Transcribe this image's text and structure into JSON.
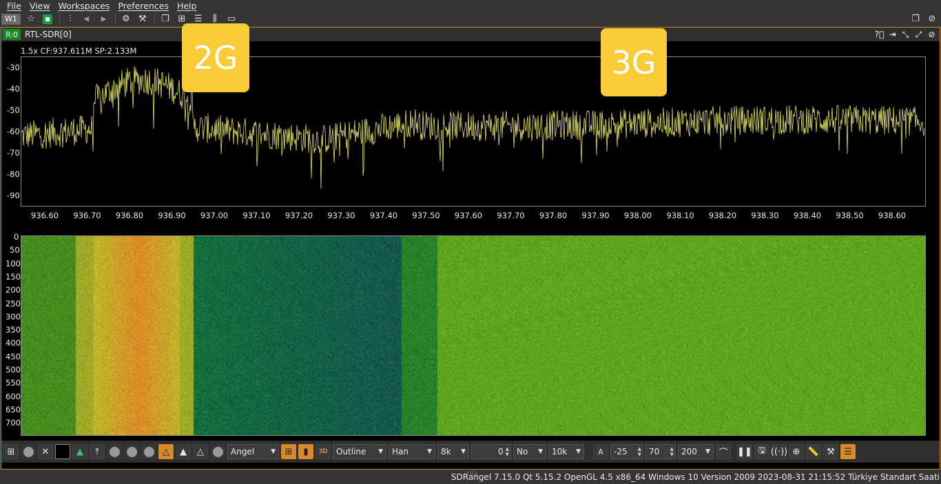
{
  "menubar": {
    "items": [
      "File",
      "View",
      "Workspaces",
      "Preferences",
      "Help"
    ]
  },
  "toolbar": {
    "workspace_badge": "W1"
  },
  "panel": {
    "rx_badge": "R:0",
    "title": "RTL-SDR[0]"
  },
  "spectrum": {
    "info_line": "1.5x CF:937.611M SP:2.133M",
    "y_ticks": [
      "-30",
      "-40",
      "-50",
      "-60",
      "-70",
      "-80",
      "-90"
    ],
    "x_ticks": [
      "936.60",
      "936.70",
      "936.80",
      "936.90",
      "937.00",
      "937.10",
      "937.20",
      "937.30",
      "937.40",
      "937.50",
      "937.60",
      "937.70",
      "937.80",
      "937.90",
      "938.00",
      "938.10",
      "938.20",
      "938.30",
      "938.40",
      "938.50",
      "938.60"
    ],
    "trace_color": "#e6e36a"
  },
  "waterfall": {
    "ticks": [
      "0",
      "50",
      "100",
      "150",
      "200",
      "250",
      "300",
      "350",
      "400",
      "450",
      "500",
      "550",
      "600",
      "650",
      "700"
    ]
  },
  "overlays": {
    "label_2g": "2G",
    "label_3g": "3G",
    "color": "#f9cc35"
  },
  "controls": {
    "palette": "Angel",
    "fft_style": "Outline",
    "window": "Han",
    "fft_size": "8k",
    "fft_overlap": "0",
    "averaging_mode": "No",
    "rate_cap": "10k",
    "auto_scale_label": "A",
    "ref_level": "-25",
    "range": "70",
    "averaging": "200",
    "three_d_label": "3D"
  },
  "status": {
    "text": "SDRangel 7.15.0 Qt 5.15.2 OpenGL 4.5 x86_64 Windows 10 Version 2009  2023-08-31 21:15:52 Türkiye Standart Saati"
  }
}
